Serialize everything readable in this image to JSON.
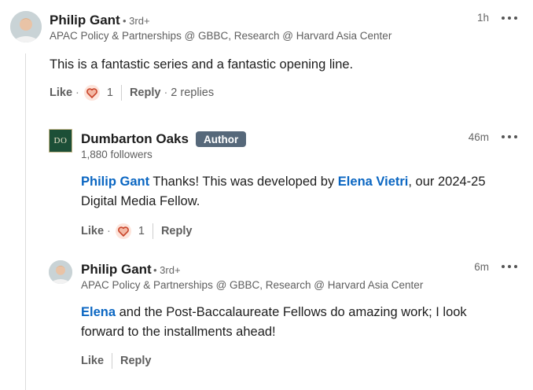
{
  "comments": [
    {
      "author": "Philip Gant",
      "degree": "• 3rd+",
      "headline": "APAC Policy & Partnerships @ GBBC, Research @ Harvard Asia Center",
      "time": "1h",
      "text": "This is a fantastic series and a fantastic opening line.",
      "like_label": "Like",
      "reaction_count": "1",
      "reply_label": "Reply",
      "replies": "2 replies"
    },
    {
      "author": "Dumbarton Oaks",
      "logo_text": "DO",
      "badge": "Author",
      "followers": "1,880 followers",
      "time": "46m",
      "mention_1": "Philip Gant",
      "text_1": " Thanks! This was developed by ",
      "mention_2": "Elena Vietri",
      "text_2": ", our 2024-25",
      "text_3": "Digital Media Fellow.",
      "like_label": "Like",
      "reaction_count": "1",
      "reply_label": "Reply"
    },
    {
      "author": "Philip Gant",
      "degree": "• 3rd+",
      "headline": "APAC Policy & Partnerships @ GBBC, Research @ Harvard Asia Center",
      "time": "6m",
      "mention_1": "Elena",
      "text_1": " and the Post-Baccalaureate Fellows do amazing work; I look",
      "text_2": "forward to the installments ahead!",
      "like_label": "Like",
      "reply_label": "Reply"
    }
  ],
  "icons": {
    "more": "more-options-icon",
    "reaction": "heart-reaction-icon"
  },
  "colors": {
    "mention": "#0a66c2",
    "badge": "#56687a",
    "reaction": "#c9452b"
  }
}
